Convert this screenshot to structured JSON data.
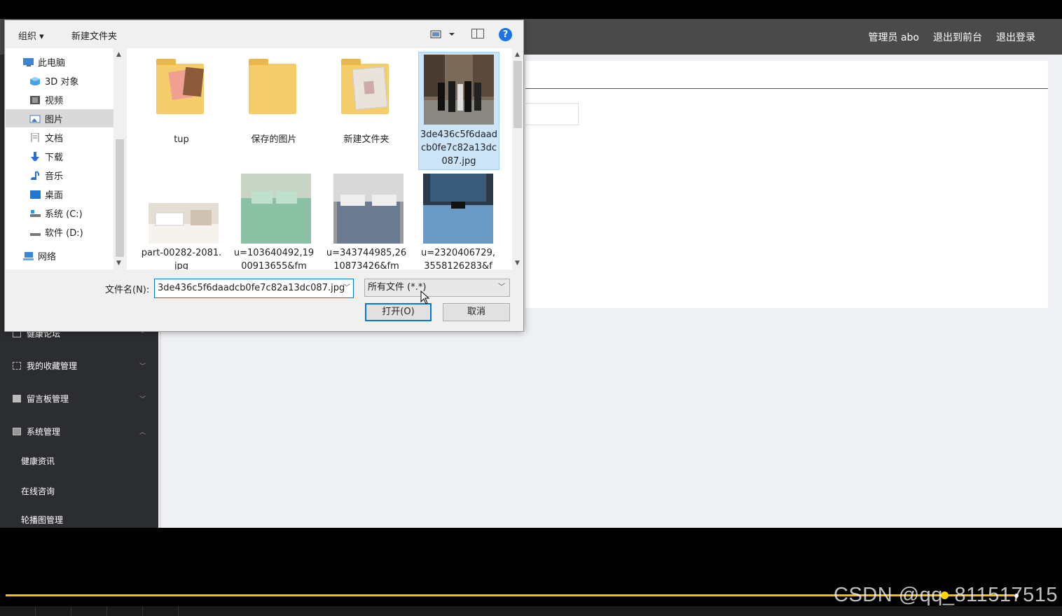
{
  "topbar": {
    "links": [
      "管理员 abo",
      "退出到前台",
      "退出登录"
    ]
  },
  "sidebar": {
    "items": [
      {
        "label": "健康论坛",
        "chevron": "down"
      },
      {
        "label": "我的收藏管理",
        "chevron": "down"
      },
      {
        "label": "留言板管理",
        "chevron": "down"
      },
      {
        "label": "系统管理",
        "chevron": "up"
      }
    ],
    "subitems": [
      "健康资讯",
      "在线咨询",
      "轮播图管理"
    ]
  },
  "dialog": {
    "toolbar": {
      "organize": "组织 ▾",
      "new_folder": "新建文件夹",
      "help": "?"
    },
    "nav": [
      {
        "label": "此电脑",
        "icon": "computer-icon"
      },
      {
        "label": "3D 对象",
        "icon": "cube-icon"
      },
      {
        "label": "视频",
        "icon": "film-icon"
      },
      {
        "label": "图片",
        "icon": "picture-icon"
      },
      {
        "label": "文档",
        "icon": "document-icon"
      },
      {
        "label": "下载",
        "icon": "download-icon"
      },
      {
        "label": "音乐",
        "icon": "music-icon"
      },
      {
        "label": "桌面",
        "icon": "desktop-icon"
      },
      {
        "label": "系统 (C:)",
        "icon": "drive-icon"
      },
      {
        "label": "软件 (D:)",
        "icon": "drive-icon"
      },
      {
        "label": "网络",
        "icon": "network-icon"
      }
    ],
    "files": [
      {
        "name": "tup",
        "type": "folder"
      },
      {
        "name": "保存的图片",
        "type": "folder"
      },
      {
        "name": "新建文件夹",
        "type": "folder"
      },
      {
        "name": "3de436c5f6daadcb0fe7c82a13dc087.jpg",
        "type": "image",
        "selected": true
      },
      {
        "name": "part-00282-2081.jpg",
        "type": "image"
      },
      {
        "name": "u=103640492,1900913655&fm",
        "type": "image"
      },
      {
        "name": "u=343744985,2610873426&fm",
        "type": "image"
      },
      {
        "name": "u=2320406729,3558126283&f",
        "type": "image"
      }
    ],
    "filename_label": "文件名(N):",
    "filename_value": "3de436c5f6daadcb0fe7c82a13dc087.jpg",
    "filetype_value": "所有文件 (*.*)",
    "open_label": "打开(O)",
    "cancel_label": "取消"
  },
  "player": {
    "progress": 0.89,
    "watermark": "CSDN @qq_811517515"
  }
}
